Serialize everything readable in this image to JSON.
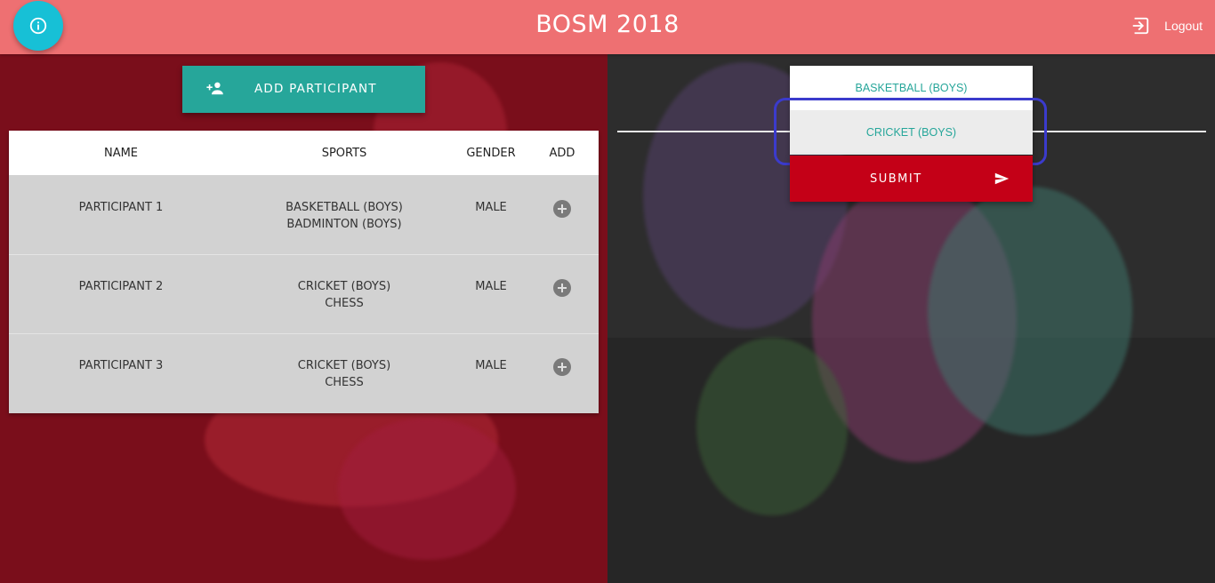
{
  "header": {
    "title": "BOSM 2018",
    "logout_label": "Logout",
    "info_icon": "info-icon",
    "logout_icon": "logout-icon"
  },
  "add_participant": {
    "label": "ADD PARTICIPANT",
    "icon": "person-add-icon"
  },
  "table": {
    "columns": [
      "NAME",
      "SPORTS",
      "GENDER",
      "ADD"
    ],
    "rows": [
      {
        "name": "PARTICIPANT 1",
        "sports": [
          "BASKETBALL (BOYS)",
          "BADMINTON (BOYS)"
        ],
        "gender": "MALE"
      },
      {
        "name": "PARTICIPANT 2",
        "sports": [
          "CRICKET (BOYS)",
          "CHESS"
        ],
        "gender": "MALE"
      },
      {
        "name": "PARTICIPANT 3",
        "sports": [
          "CRICKET (BOYS)",
          "CHESS"
        ],
        "gender": "MALE"
      }
    ]
  },
  "sport_select": {
    "options": [
      "BASKETBALL (BOYS)",
      "CRICKET (BOYS)"
    ],
    "selected": "CRICKET (BOYS)"
  },
  "submit": {
    "label": "SUBMIT",
    "icon": "send-icon"
  },
  "colors": {
    "header": "#ee7072",
    "accent": "#26a69a",
    "info_button": "#17c0d6",
    "submit": "#c40017",
    "left_background": "#7a0e1b",
    "right_background": "#2d2d2d",
    "highlight": "#3b3bcc"
  }
}
